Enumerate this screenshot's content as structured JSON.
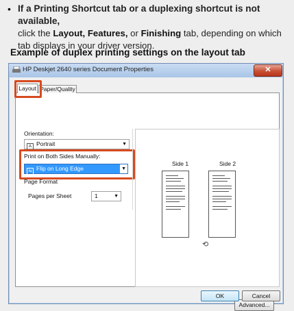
{
  "instruction": {
    "bullet": "•",
    "line1": "If a Printing Shortcut tab or a duplexing shortcut is not available,",
    "line2_pre": "click the ",
    "line2_b1": "Layout, Features,",
    "line2_mid": " or ",
    "line2_b2": "Finishing",
    "line2_post": " tab, depending on which",
    "line3": "tab displays in your driver version."
  },
  "example_heading": "Example of duplex printing settings on the layout tab",
  "dialog": {
    "title": "HP Deskjet 2640 series Document Properties",
    "close_glyph": "✕",
    "tabs": [
      {
        "label": "Layout"
      },
      {
        "label": "Paper/Quality"
      }
    ],
    "orientation_label": "Orientation:",
    "orientation_value": "Portrait",
    "print_both_sides_label": "Print on Both Sides Manually:",
    "print_both_sides_value": "Flip on Long Edge",
    "page_format_label": "Page Format",
    "pages_per_sheet_label": "Pages per Sheet",
    "pages_per_sheet_value": "1",
    "preview": {
      "side1": "Side 1",
      "side2": "Side 2"
    },
    "buttons": {
      "advanced": "Advanced...",
      "ok": "OK",
      "cancel": "Cancel"
    }
  },
  "colors": {
    "highlight": "#d64a1f",
    "selection": "#3399ff"
  }
}
